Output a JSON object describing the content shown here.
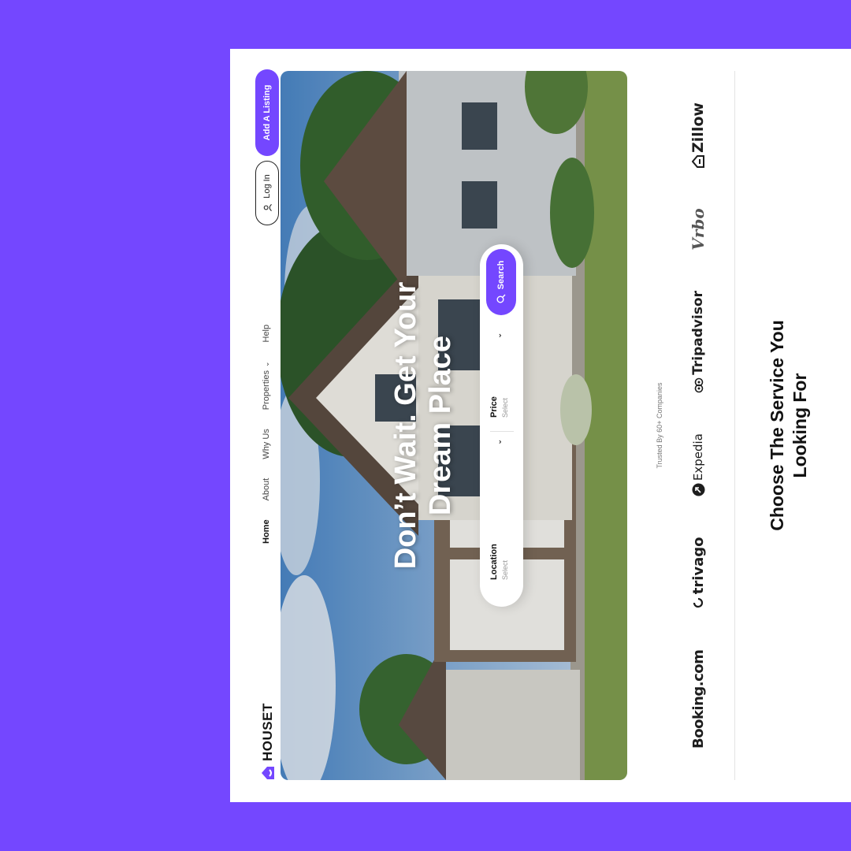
{
  "brand": {
    "name": "HOUSET"
  },
  "nav": {
    "items": [
      {
        "label": "Home",
        "active": true
      },
      {
        "label": "About"
      },
      {
        "label": "Why Us"
      },
      {
        "label": "Properties",
        "has_dropdown": true
      },
      {
        "label": "Help"
      }
    ],
    "login_label": "Log In",
    "add_listing_label": "Add A Listing"
  },
  "hero": {
    "title_line1": "Don’t Wait. Get Your",
    "title_line2": "Dream Place"
  },
  "search": {
    "location_label": "Location",
    "location_value": "Select",
    "price_label": "Price",
    "price_value": "Select",
    "button_label": "Search"
  },
  "trusted": {
    "text": "Trusted By 60+ Companies",
    "brands": [
      "Booking.com",
      "trivago",
      "Expedia",
      "Tripadvisor",
      "Vrbo",
      "Zillow"
    ]
  },
  "section": {
    "title_line1": "Choose The Service You",
    "title_line2": "Looking For"
  },
  "colors": {
    "accent": "#7447FF",
    "background": "#7447FF",
    "card": "#FFFFFF"
  },
  "icons": [
    "house-logo-icon",
    "user-icon",
    "chevron-down-icon",
    "search-icon"
  ]
}
